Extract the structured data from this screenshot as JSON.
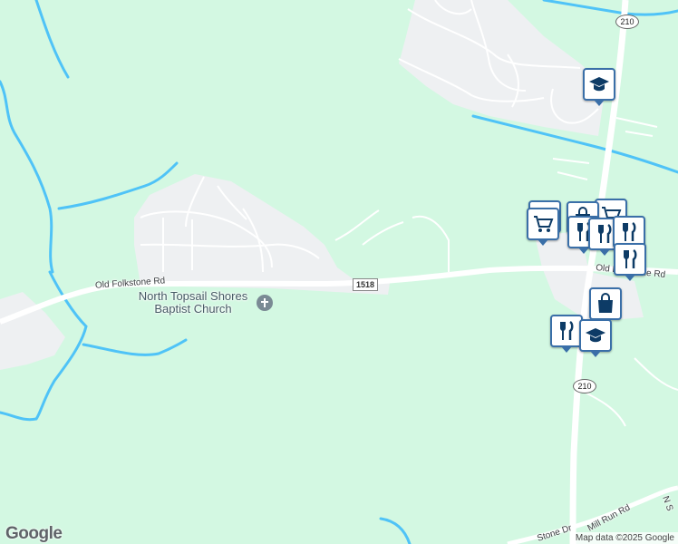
{
  "map": {
    "colors": {
      "land": "#d3f8e2",
      "developed": "#eef0f2",
      "water": "#4fc3f7",
      "road": "#ffffff",
      "poi_border": "#3a6fa8"
    },
    "road_labels": {
      "old_folkstone": "Old Folkstone Rd",
      "old_folkstone_east": "Old Folkstone Rd",
      "mill_run": "Mill Run Rd",
      "stone_dr": "Stone Dr",
      "south_edge": "N S"
    },
    "shields": {
      "route_1518": "1518",
      "route_210_north": "210",
      "route_210_south": "210"
    },
    "place": {
      "church": "North Topsail Shores Baptist Church"
    },
    "poi_icons": [
      {
        "icon": "graduation-cap-icon",
        "category": "school"
      },
      {
        "icon": "shopping-cart-icon",
        "category": "grocery"
      },
      {
        "icon": "shopping-cart-icon",
        "category": "grocery"
      },
      {
        "icon": "shopping-bag-icon",
        "category": "shopping"
      },
      {
        "icon": "shopping-cart-icon",
        "category": "grocery"
      },
      {
        "icon": "fork-knife-icon",
        "category": "restaurant"
      },
      {
        "icon": "fork-knife-icon",
        "category": "restaurant"
      },
      {
        "icon": "fork-knife-icon",
        "category": "restaurant"
      },
      {
        "icon": "fork-knife-icon",
        "category": "restaurant"
      },
      {
        "icon": "shopping-bag-icon",
        "category": "shopping"
      },
      {
        "icon": "fork-knife-icon",
        "category": "restaurant"
      },
      {
        "icon": "graduation-cap-icon",
        "category": "school"
      }
    ],
    "logo": "Google",
    "attribution": "Map data ©2025 Google"
  }
}
